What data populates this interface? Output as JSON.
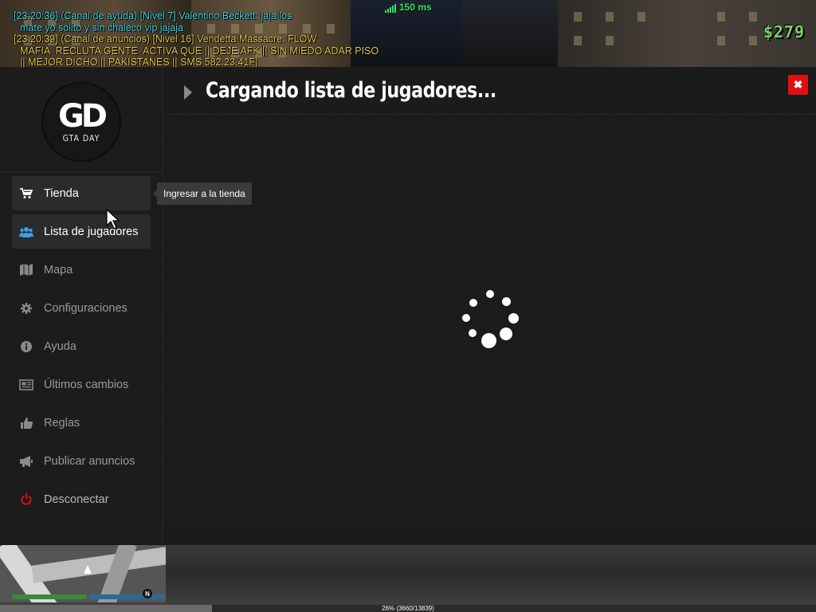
{
  "chat": {
    "lines": [
      {
        "type": "help",
        "text": "[23:20:36] (Canal de ayuda) [Nivel 7] Valentino Beckett: jaja los"
      },
      {
        "type": "help-cont",
        "text": "mate yo solito y sin chaleco vip jajaja"
      },
      {
        "type": "ann",
        "text": "[23:20:39] (Canal de anuncios) [Nivel 16] Vendetta Massacre: FLOW"
      },
      {
        "type": "ann-cont",
        "text": "MAFIA  RECLUTA GENTE  ACTIVA QUE || DEJE AFK || SIN MIEDO ADAR PISO"
      },
      {
        "type": "ann-cont",
        "text": "|| MEJOR DICHO || PAKISTANES || SMS 582.23.41F|"
      }
    ]
  },
  "hud": {
    "ping": "150 ms",
    "money": "$279",
    "download_progress": 0.26,
    "download_text": "26% (3660/13839)",
    "compass": "N"
  },
  "logo": {
    "mark": "GD",
    "subtitle": "GTA DAY"
  },
  "nav": [
    {
      "label": "Tienda",
      "icon": "shopping-cart-icon"
    },
    {
      "label": "Lista de jugadores",
      "icon": "users-icon"
    },
    {
      "label": "Mapa",
      "icon": "map-icon"
    },
    {
      "label": "Configuraciones",
      "icon": "gear-icon"
    },
    {
      "label": "Ayuda",
      "icon": "info-icon"
    },
    {
      "label": "Últimos cambios",
      "icon": "newspaper-icon"
    },
    {
      "label": "Reglas",
      "icon": "thumbs-up-icon"
    },
    {
      "label": "Publicar anuncios",
      "icon": "megaphone-icon"
    },
    {
      "label": "Desconectar",
      "icon": "power-icon"
    }
  ],
  "tooltip": "Ingresar a la tienda",
  "header": {
    "title": "Cargando lista de jugadores...",
    "close_symbol": "✖"
  },
  "colors": {
    "accent_blue": "#3aa0e8",
    "danger": "#e01010",
    "ping_green": "#38e05a",
    "money_green": "#7ccf6a",
    "chat_help": "#3fd7e6",
    "chat_announce": "#e6c84a"
  }
}
